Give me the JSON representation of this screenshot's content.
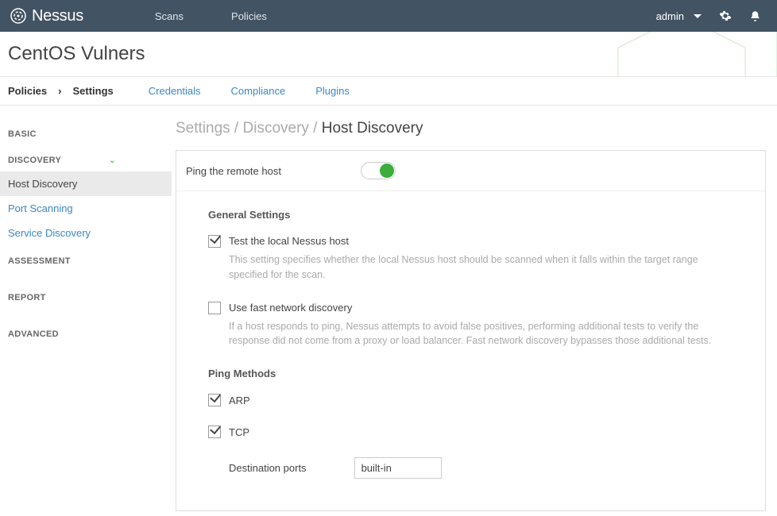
{
  "topbar": {
    "brand": "Nessus",
    "nav": {
      "scans": "Scans",
      "policies": "Policies"
    },
    "user": "admin"
  },
  "page": {
    "title": "CentOS Vulners"
  },
  "tabs": {
    "crumb1": "Policies",
    "crumb2": "Settings",
    "credentials": "Credentials",
    "compliance": "Compliance",
    "plugins": "Plugins"
  },
  "sidebar": {
    "basic": "BASIC",
    "discovery": "DISCOVERY",
    "items": {
      "host": "Host Discovery",
      "port": "Port Scanning",
      "service": "Service Discovery"
    },
    "assessment": "ASSESSMENT",
    "report": "REPORT",
    "advanced": "ADVANCED"
  },
  "breadcrumb": {
    "a": "Settings",
    "b": "Discovery",
    "c": "Host Discovery"
  },
  "settings": {
    "pingRemote": "Ping the remote host",
    "general": {
      "title": "General Settings",
      "testLocal": {
        "label": "Test the local Nessus host",
        "desc": "This setting specifies whether the local Nessus host should be scanned when it falls within the target range specified for the scan."
      },
      "fastNet": {
        "label": "Use fast network discovery",
        "desc": "If a host responds to ping, Nessus attempts to avoid false positives, performing additional tests to verify the response did not come from a proxy or load balancer. Fast network discovery bypasses those additional tests."
      }
    },
    "pingMethods": {
      "title": "Ping Methods",
      "arp": "ARP",
      "tcp": "TCP",
      "destPorts": "Destination ports",
      "destPortsValue": "built-in"
    }
  }
}
